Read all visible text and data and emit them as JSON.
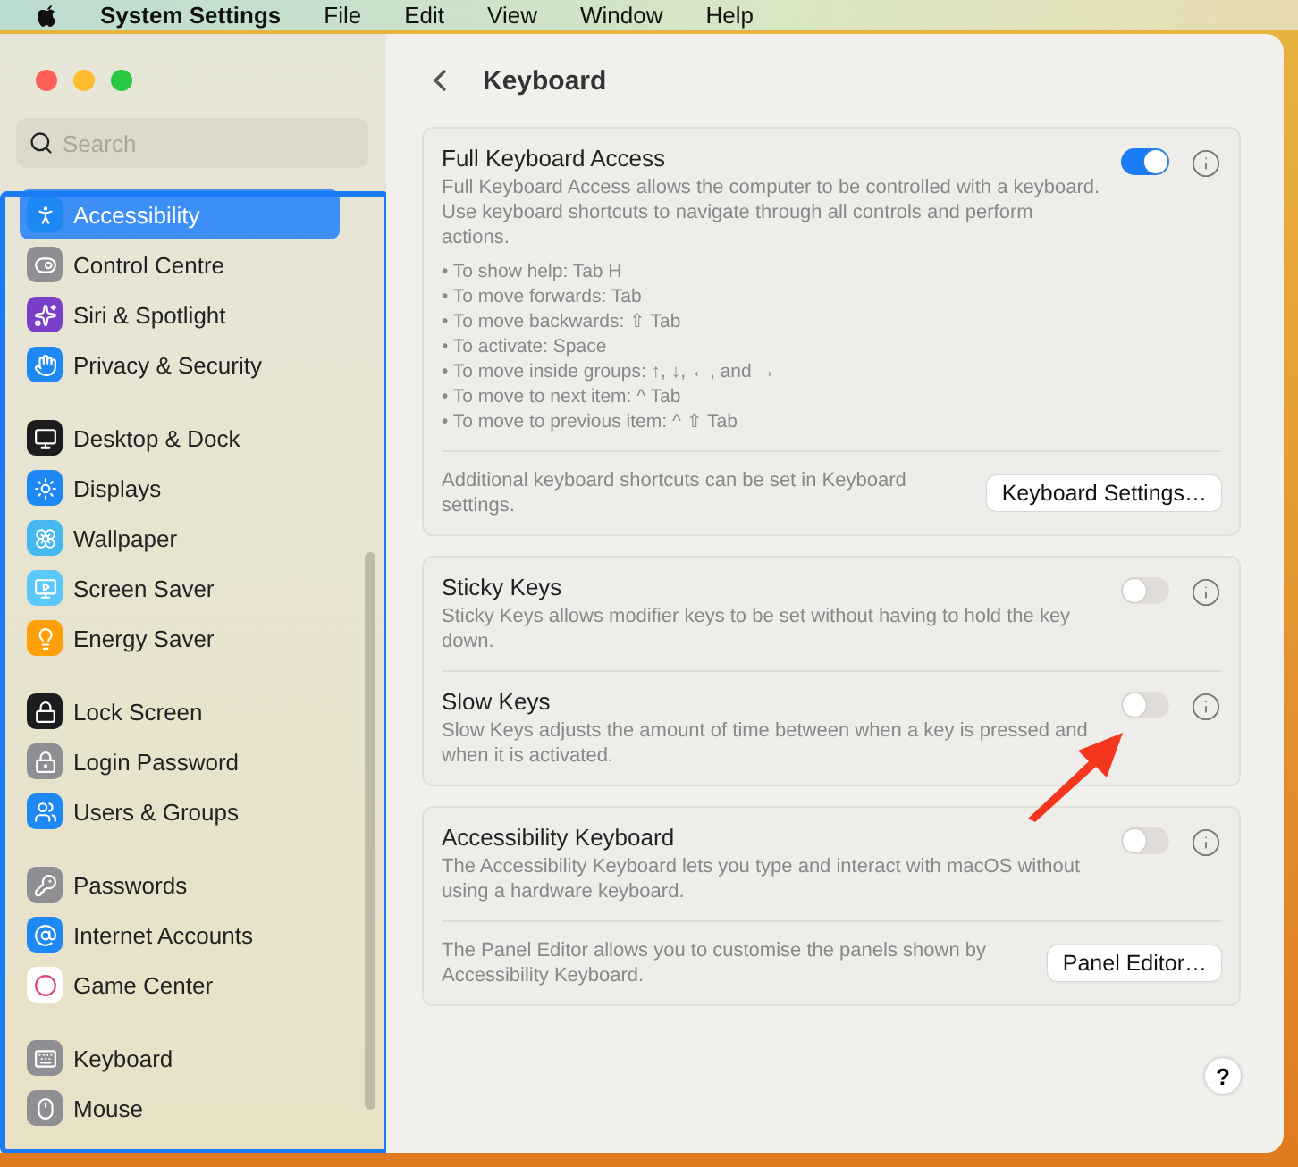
{
  "menu_bar": {
    "app": "System Settings",
    "items": [
      "File",
      "Edit",
      "View",
      "Window",
      "Help"
    ]
  },
  "sidebar": {
    "search": {
      "placeholder": "Search"
    },
    "groups": [
      {
        "items": [
          {
            "label": "Accessibility",
            "selected": true,
            "color": "#1e88f5"
          },
          {
            "label": "Control Centre",
            "selected": false,
            "color": "#8e8e93"
          },
          {
            "label": "Siri & Spotlight",
            "selected": false,
            "color": "#7a3fc8"
          },
          {
            "label": "Privacy & Security",
            "selected": false,
            "color": "#1e88f5"
          }
        ]
      },
      {
        "items": [
          {
            "label": "Desktop & Dock",
            "selected": false,
            "color": "#1c1c1e"
          },
          {
            "label": "Displays",
            "selected": false,
            "color": "#1e88f5"
          },
          {
            "label": "Wallpaper",
            "selected": false,
            "color": "#45b8f0"
          },
          {
            "label": "Screen Saver",
            "selected": false,
            "color": "#5ac8fa"
          },
          {
            "label": "Energy Saver",
            "selected": false,
            "color": "#ff9f0a"
          }
        ]
      },
      {
        "items": [
          {
            "label": "Lock Screen",
            "selected": false,
            "color": "#1c1c1e"
          },
          {
            "label": "Login Password",
            "selected": false,
            "color": "#8e8e93"
          },
          {
            "label": "Users & Groups",
            "selected": false,
            "color": "#1e88f5"
          }
        ]
      },
      {
        "items": [
          {
            "label": "Passwords",
            "selected": false,
            "color": "#8e8e93"
          },
          {
            "label": "Internet Accounts",
            "selected": false,
            "color": "#1e88f5"
          },
          {
            "label": "Game Center",
            "selected": false,
            "color": "#ffffff"
          }
        ]
      },
      {
        "items": [
          {
            "label": "Keyboard",
            "selected": false,
            "color": "#8e8e93"
          },
          {
            "label": "Mouse",
            "selected": false,
            "color": "#8e8e93"
          }
        ]
      }
    ]
  },
  "page": {
    "title": "Keyboard",
    "cards": [
      {
        "rows": [
          {
            "kind": "toggle",
            "title": "Full Keyboard Access",
            "description": "Full Keyboard Access allows the computer to be controlled with a keyboard. Use keyboard shortcuts to navigate through all controls and perform actions.",
            "on": true,
            "bullets": [
              "• To show help: Tab H",
              "• To move forwards: Tab",
              "• To move backwards: ⇧ Tab",
              "• To activate: Space",
              "• To move inside groups: ↑, ↓, ←, and →",
              "• To move to next item: ^ Tab",
              "• To move to previous item: ^ ⇧ Tab"
            ]
          },
          {
            "kind": "button",
            "text": "Additional keyboard shortcuts can be set in Keyboard settings.",
            "button": "Keyboard Settings…"
          }
        ]
      },
      {
        "rows": [
          {
            "kind": "toggle",
            "title": "Sticky Keys",
            "description": "Sticky Keys allows modifier keys to be set without having to hold the key down.",
            "on": false
          },
          {
            "kind": "toggle",
            "title": "Slow Keys",
            "description": "Slow Keys adjusts the amount of time between when a key is pressed and when it is activated.",
            "on": false
          }
        ]
      },
      {
        "rows": [
          {
            "kind": "toggle",
            "title": "Accessibility Keyboard",
            "description": "The Accessibility Keyboard lets you type and interact with macOS without using a hardware keyboard.",
            "on": false
          },
          {
            "kind": "button",
            "text": "The Panel Editor allows you to customise the panels shown by Accessibility Keyboard.",
            "button": "Panel Editor…"
          }
        ]
      }
    ],
    "help": "?"
  }
}
